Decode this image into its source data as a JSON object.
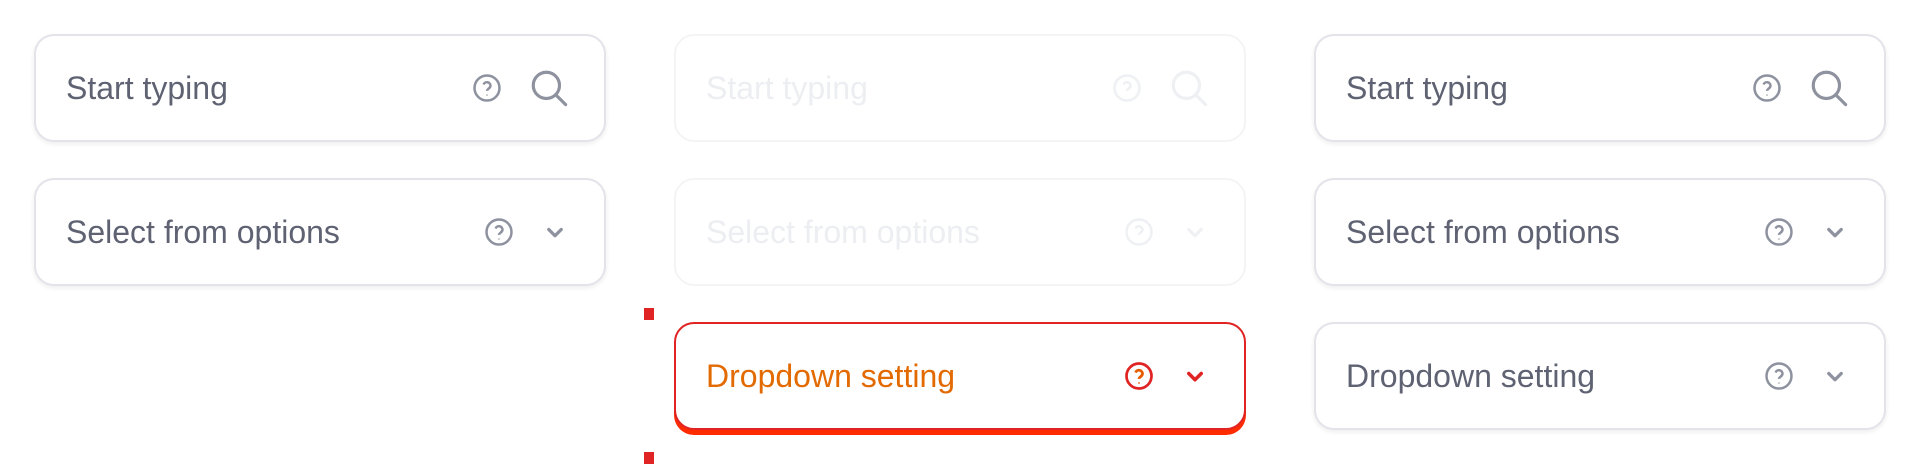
{
  "columns": [
    {
      "state": "default",
      "fields": [
        {
          "label": "Start typing",
          "icons": [
            "help-icon",
            "search-icon"
          ]
        },
        {
          "label": "Select from options",
          "icons": [
            "help-icon",
            "chevron-down-icon"
          ]
        }
      ]
    },
    {
      "state": "disabled",
      "fields": [
        {
          "label": "Start typing",
          "icons": [
            "help-icon",
            "search-icon"
          ]
        },
        {
          "label": "Select from options",
          "icons": [
            "help-icon",
            "chevron-down-icon"
          ]
        },
        {
          "label": "Dropdown setting",
          "icons": [
            "help-icon",
            "chevron-down-icon"
          ],
          "state": "error"
        }
      ]
    },
    {
      "state": "default",
      "fields": [
        {
          "label": "Start typing",
          "icons": [
            "help-icon",
            "search-icon"
          ]
        },
        {
          "label": "Select from options",
          "icons": [
            "help-icon",
            "chevron-down-icon"
          ]
        },
        {
          "label": "Dropdown setting",
          "icons": [
            "help-icon",
            "chevron-down-icon"
          ]
        }
      ]
    }
  ],
  "colors": {
    "text": "#5e6272",
    "icon": "#8e929f",
    "border": "#e3e4ea",
    "disabled_text": "#eceef2",
    "error_border": "#e02424",
    "error_shadow": "#ff2b00",
    "error_text": "#e26a00"
  }
}
